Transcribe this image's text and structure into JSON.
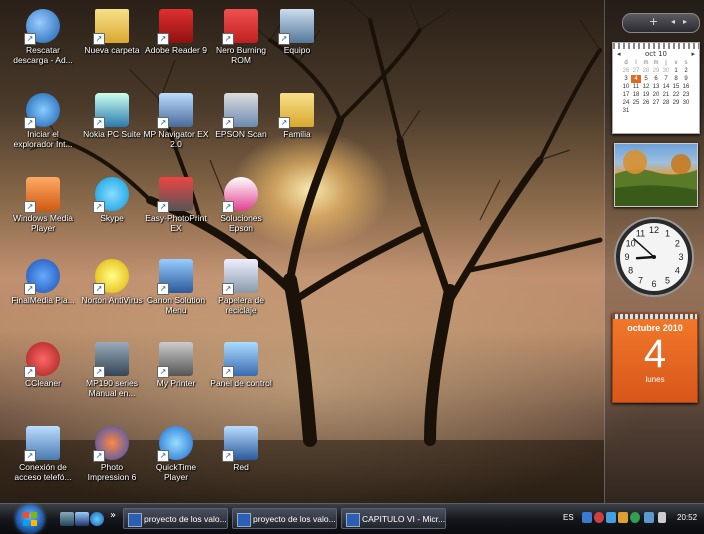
{
  "desktop": {
    "icons": [
      {
        "label": "Rescatar descarga - Ad...",
        "icon": "globe-download-icon"
      },
      {
        "label": "Nueva carpeta",
        "icon": "folder-icon"
      },
      {
        "label": "Adobe Reader 9",
        "icon": "adobe-reader-icon"
      },
      {
        "label": "Nero Burning ROM",
        "icon": "nero-icon"
      },
      {
        "label": "Equipo",
        "icon": "computer-icon"
      },
      {
        "label": "Iniciar el explorador Int...",
        "icon": "internet-explorer-icon"
      },
      {
        "label": "Nokia PC Suite",
        "icon": "nokia-suite-icon"
      },
      {
        "label": "MP Navigator EX 2.0",
        "icon": "mp-navigator-icon"
      },
      {
        "label": "EPSON Scan",
        "icon": "epson-scan-icon"
      },
      {
        "label": "Familia",
        "icon": "folder-icon"
      },
      {
        "label": "Windows Media Player",
        "icon": "media-player-icon"
      },
      {
        "label": "Skype",
        "icon": "skype-icon"
      },
      {
        "label": "Easy-PhotoPrint EX",
        "icon": "photoprint-icon"
      },
      {
        "label": "Soluciones Epson",
        "icon": "epson-icon"
      },
      {
        "label": "FinalMedia Pla...",
        "icon": "play-icon"
      },
      {
        "label": "Norton AntiVirus",
        "icon": "norton-icon"
      },
      {
        "label": "Canon Solution Menu",
        "icon": "canon-icon"
      },
      {
        "label": "Papelera de reciclaje",
        "icon": "recycle-bin-icon"
      },
      {
        "label": "CCleaner",
        "icon": "ccleaner-icon"
      },
      {
        "label": "MP190 series Manual en...",
        "icon": "manual-icon"
      },
      {
        "label": "My Printer",
        "icon": "printer-icon"
      },
      {
        "label": "Panel de control",
        "icon": "control-panel-icon"
      },
      {
        "label": "Conexión de acceso telefó...",
        "icon": "dialup-icon"
      },
      {
        "label": "Photo Impression 6",
        "icon": "photo-impression-icon"
      },
      {
        "label": "QuickTime Player",
        "icon": "quicktime-icon"
      },
      {
        "label": "Red",
        "icon": "network-icon"
      }
    ]
  },
  "sidebar": {
    "calendar": {
      "month_label": "oct 10",
      "weekdays": [
        "d",
        "l",
        "m",
        "m",
        "j",
        "v",
        "s"
      ],
      "weeks": [
        [
          "26",
          "27",
          "28",
          "29",
          "30",
          "1",
          "2"
        ],
        [
          "3",
          "4",
          "5",
          "6",
          "7",
          "8",
          "9"
        ],
        [
          "10",
          "11",
          "12",
          "13",
          "14",
          "15",
          "16"
        ],
        [
          "17",
          "18",
          "19",
          "20",
          "21",
          "22",
          "23"
        ],
        [
          "24",
          "25",
          "26",
          "27",
          "28",
          "29",
          "30"
        ],
        [
          "31",
          "",
          "",
          "",
          "",
          "",
          ""
        ]
      ],
      "today": "4"
    },
    "clock": {
      "hour": 8,
      "minute": 52,
      "numerals": [
        "12",
        "1",
        "2",
        "3",
        "4",
        "5",
        "6",
        "7",
        "8",
        "9",
        "10",
        "11"
      ]
    },
    "date_card": {
      "month_year": "octubre 2010",
      "day": "4",
      "weekday": "lunes"
    }
  },
  "taskbar": {
    "quick_launch_more": "»",
    "buttons": [
      {
        "label": "proyecto de los valo..."
      },
      {
        "label": "proyecto de los valo..."
      },
      {
        "label": "CAPITULO VI - Micr..."
      }
    ],
    "language": "ES",
    "time": "20:52"
  },
  "colors": {
    "accent": "#e06a20",
    "taskbar": "#15171c"
  }
}
